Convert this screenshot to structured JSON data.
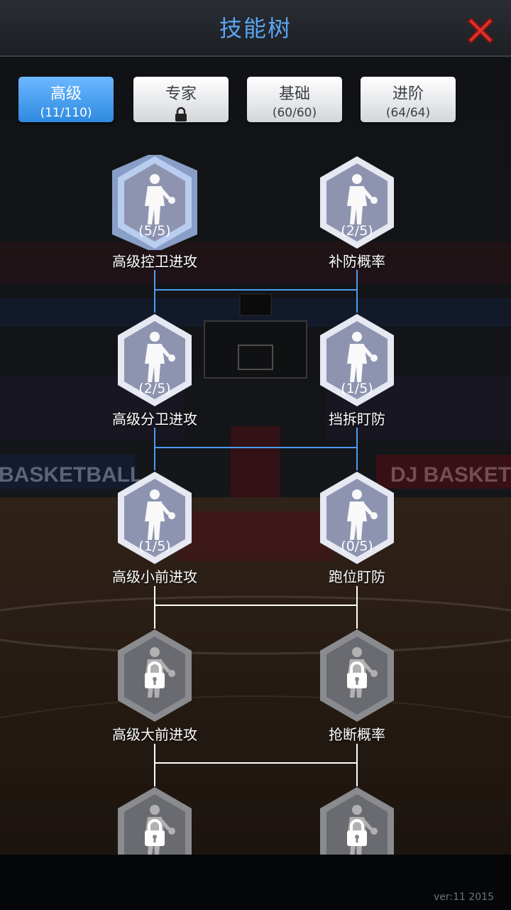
{
  "header": {
    "title": "技能树",
    "close_icon": "close-x-icon"
  },
  "tabs": [
    {
      "name": "高级",
      "count": "(11/110)",
      "active": true,
      "locked": false
    },
    {
      "name": "专家",
      "count": "",
      "active": false,
      "locked": true
    },
    {
      "name": "基础",
      "count": "(60/60)",
      "active": false,
      "locked": false
    },
    {
      "name": "进阶",
      "count": "(64/64)",
      "active": false,
      "locked": false
    }
  ],
  "skills": [
    {
      "key": "pg-offense",
      "label": "高级控卫进攻",
      "level": "(5/5)",
      "state": "maxed",
      "icon": "dribbling-player-icon"
    },
    {
      "key": "help-defense",
      "label": "补防概率",
      "level": "(2/5)",
      "state": "unlocked",
      "icon": "help-defense-players-icon"
    },
    {
      "key": "sg-offense",
      "label": "高级分卫进攻",
      "level": "(2/5)",
      "state": "unlocked",
      "icon": "jump-shot-player-icon"
    },
    {
      "key": "pick-defense",
      "label": "挡拆盯防",
      "level": "(1/5)",
      "state": "unlocked",
      "icon": "pick-and-roll-players-icon"
    },
    {
      "key": "sf-offense",
      "label": "高级小前进攻",
      "level": "(1/5)",
      "state": "unlocked",
      "icon": "layup-player-icon"
    },
    {
      "key": "run-defense",
      "label": "跑位盯防",
      "level": "(0/5)",
      "state": "unlocked",
      "icon": "running-defense-players-icon"
    },
    {
      "key": "pf-offense",
      "label": "高级大前进攻",
      "level": "",
      "state": "locked",
      "icon": "post-player-icon"
    },
    {
      "key": "steal",
      "label": "抢断概率",
      "level": "",
      "state": "locked",
      "icon": "steal-players-icon"
    },
    {
      "key": "c-offense",
      "label": "",
      "level": "",
      "state": "locked",
      "icon": "dunk-player-icon"
    },
    {
      "key": "defense-5",
      "label": "",
      "level": "",
      "state": "locked",
      "icon": "group-defense-players-icon"
    }
  ],
  "footer": {
    "version": "ver:11  2015"
  },
  "colors": {
    "title": "#5aa6f0",
    "active_tab": "#3d96ea",
    "link_active": "#4a9cf2",
    "link_inactive": "#ffffff",
    "close": "#e0322c"
  }
}
